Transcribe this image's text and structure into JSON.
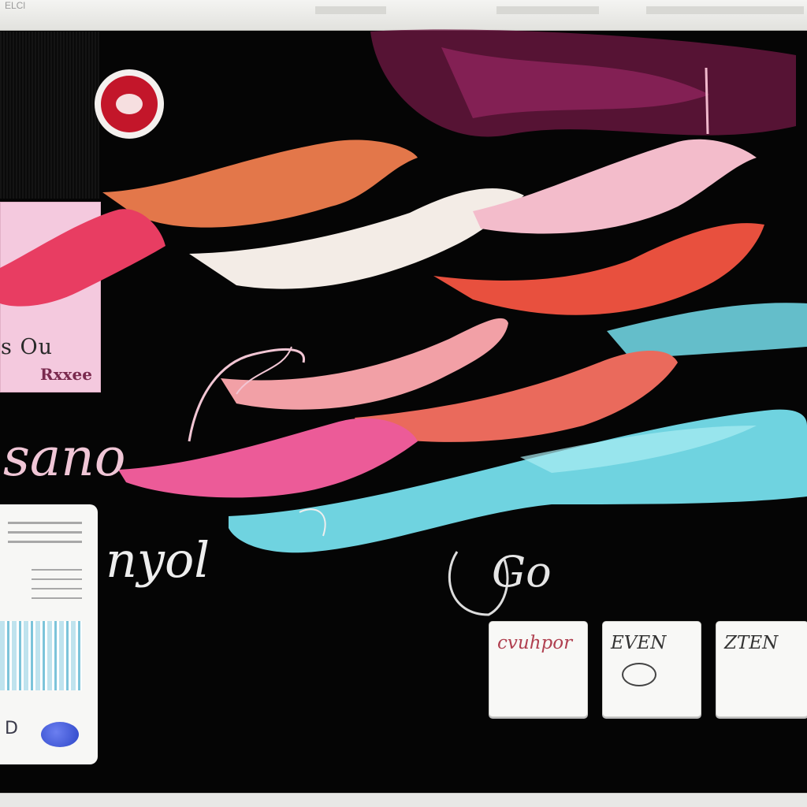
{
  "window": {
    "title": "ELCl"
  },
  "sidebar": {
    "pink_card": {
      "line1": "s Ou",
      "line2": "Rxxee"
    },
    "doc_card": {
      "letter": "D"
    }
  },
  "canvas": {
    "script_texts": [
      "sano",
      "nyol",
      "Go"
    ]
  },
  "keys": [
    {
      "label": "cvuhpor"
    },
    {
      "label": "EVEN"
    },
    {
      "label": "ZTEN"
    }
  ],
  "colors": {
    "background": "#050505",
    "accent_red": "#c3162a",
    "card_pink": "#f4c9de",
    "stroke_orange": "#e3774a",
    "stroke_cream": "#f3ece6",
    "stroke_pink": "#f2a0b4",
    "stroke_coral": "#e8503e",
    "stroke_magenta": "#ec5b98",
    "stroke_cyan": "#6fd3e0"
  },
  "icons": {
    "record": "record-icon"
  }
}
